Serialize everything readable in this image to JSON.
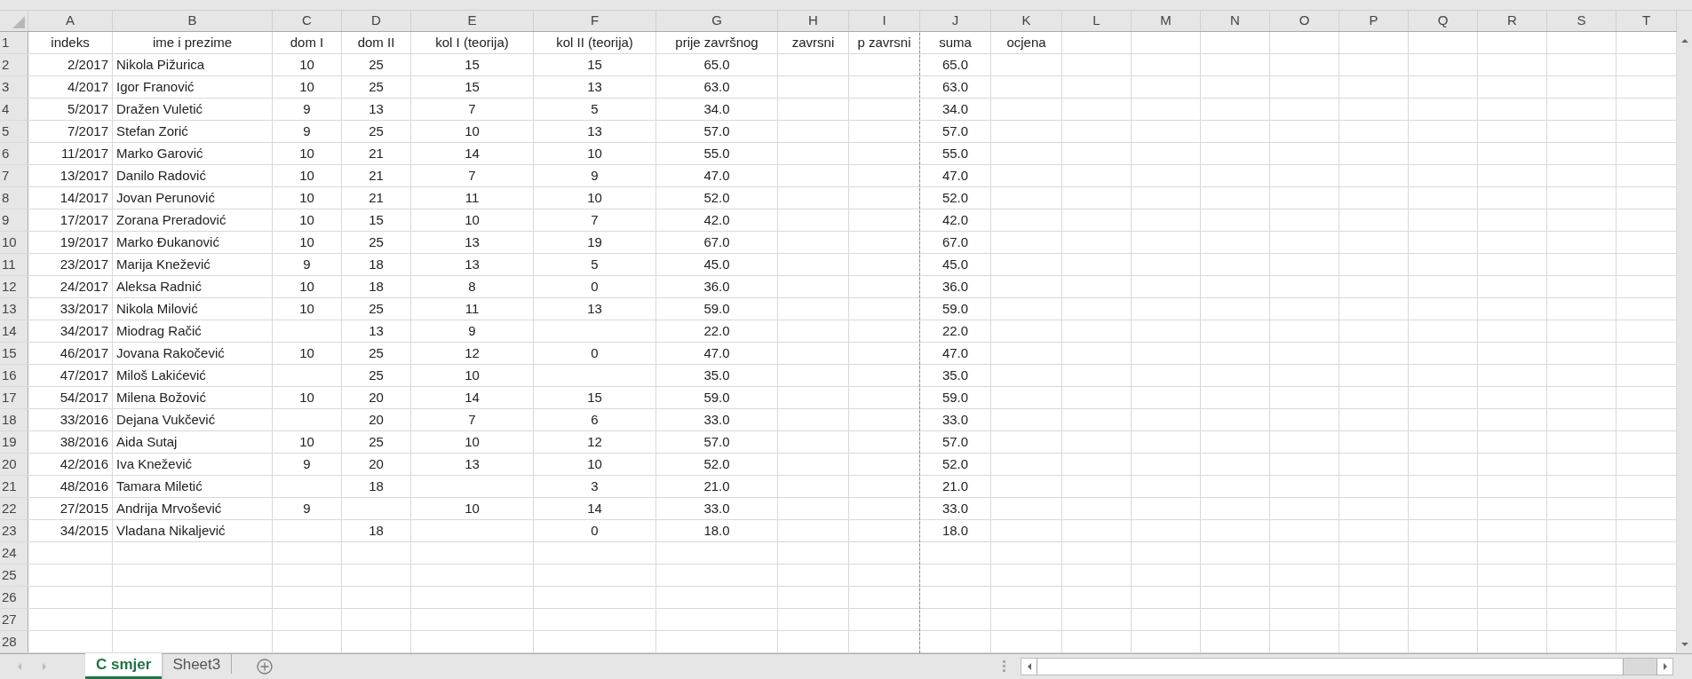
{
  "columns": [
    "A",
    "B",
    "C",
    "D",
    "E",
    "F",
    "G",
    "H",
    "I",
    "J",
    "K",
    "L",
    "M",
    "N",
    "O",
    "P",
    "Q",
    "R",
    "S",
    "T"
  ],
  "rows": [
    {
      "number": "1",
      "cells": [
        "indeks",
        "ime i prezime",
        "dom I",
        "dom II",
        "kol I (teorija)",
        "kol II (teorija)",
        "prije završnog",
        "zavrsni",
        "p zavrsni",
        "suma",
        "ocjena"
      ]
    },
    {
      "number": "2",
      "cells": [
        "2/2017",
        "Nikola Pižurica",
        "10",
        "25",
        "15",
        "15",
        "65.0",
        null,
        null,
        "65.0",
        null
      ]
    },
    {
      "number": "3",
      "cells": [
        "4/2017",
        "Igor Franović",
        "10",
        "25",
        "15",
        "13",
        "63.0",
        null,
        null,
        "63.0",
        null
      ]
    },
    {
      "number": "4",
      "cells": [
        "5/2017",
        "Dražen Vuletić",
        "9",
        "13",
        "7",
        "5",
        "34.0",
        null,
        null,
        "34.0",
        null
      ]
    },
    {
      "number": "5",
      "cells": [
        "7/2017",
        "Stefan Zorić",
        "9",
        "25",
        "10",
        "13",
        "57.0",
        null,
        null,
        "57.0",
        null
      ]
    },
    {
      "number": "6",
      "cells": [
        "11/2017",
        "Marko Garović",
        "10",
        "21",
        "14",
        "10",
        "55.0",
        null,
        null,
        "55.0",
        null
      ]
    },
    {
      "number": "7",
      "cells": [
        "13/2017",
        "Danilo Radović",
        "10",
        "21",
        "7",
        "9",
        "47.0",
        null,
        null,
        "47.0",
        null
      ]
    },
    {
      "number": "8",
      "cells": [
        "14/2017",
        "Jovan Perunović",
        "10",
        "21",
        "11",
        "10",
        "52.0",
        null,
        null,
        "52.0",
        null
      ]
    },
    {
      "number": "9",
      "cells": [
        "17/2017",
        "Zorana Preradović",
        "10",
        "15",
        "10",
        "7",
        "42.0",
        null,
        null,
        "42.0",
        null
      ]
    },
    {
      "number": "10",
      "cells": [
        "19/2017",
        "Marko Đukanović",
        "10",
        "25",
        "13",
        "19",
        "67.0",
        null,
        null,
        "67.0",
        null
      ]
    },
    {
      "number": "11",
      "cells": [
        "23/2017",
        "Marija Knežević",
        "9",
        "18",
        "13",
        "5",
        "45.0",
        null,
        null,
        "45.0",
        null
      ]
    },
    {
      "number": "12",
      "cells": [
        "24/2017",
        "Aleksa Radnić",
        "10",
        "18",
        "8",
        "0",
        "36.0",
        null,
        null,
        "36.0",
        null
      ]
    },
    {
      "number": "13",
      "cells": [
        "33/2017",
        "Nikola Milović",
        "10",
        "25",
        "11",
        "13",
        "59.0",
        null,
        null,
        "59.0",
        null
      ]
    },
    {
      "number": "14",
      "cells": [
        "34/2017",
        "Miodrag Račić",
        null,
        "13",
        "9",
        null,
        "22.0",
        null,
        null,
        "22.0",
        null
      ]
    },
    {
      "number": "15",
      "cells": [
        "46/2017",
        "Jovana Rakočević",
        "10",
        "25",
        "12",
        "0",
        "47.0",
        null,
        null,
        "47.0",
        null
      ]
    },
    {
      "number": "16",
      "cells": [
        "47/2017",
        "Miloš Lakićević",
        null,
        "25",
        "10",
        null,
        "35.0",
        null,
        null,
        "35.0",
        null
      ]
    },
    {
      "number": "17",
      "cells": [
        "54/2017",
        "Milena Božović",
        "10",
        "20",
        "14",
        "15",
        "59.0",
        null,
        null,
        "59.0",
        null
      ]
    },
    {
      "number": "18",
      "cells": [
        "33/2016",
        "Dejana Vukčević",
        null,
        "20",
        "7",
        "6",
        "33.0",
        null,
        null,
        "33.0",
        null
      ]
    },
    {
      "number": "19",
      "cells": [
        "38/2016",
        "Aida Sutaj",
        "10",
        "25",
        "10",
        "12",
        "57.0",
        null,
        null,
        "57.0",
        null
      ]
    },
    {
      "number": "20",
      "cells": [
        "42/2016",
        "Iva Knežević",
        "9",
        "20",
        "13",
        "10",
        "52.0",
        null,
        null,
        "52.0",
        null
      ]
    },
    {
      "number": "21",
      "cells": [
        "48/2016",
        "Tamara Miletić",
        null,
        "18",
        null,
        "3",
        "21.0",
        null,
        null,
        "21.0",
        null
      ]
    },
    {
      "number": "22",
      "cells": [
        "27/2015",
        "Andrija Mrvošević",
        "9",
        null,
        "10",
        "14",
        "33.0",
        null,
        null,
        "33.0",
        null
      ]
    },
    {
      "number": "23",
      "cells": [
        "34/2015",
        "Vladana Nikaljević",
        null,
        "18",
        null,
        "0",
        "18.0",
        null,
        null,
        "18.0",
        null
      ]
    },
    {
      "number": "24"
    },
    {
      "number": "25"
    },
    {
      "number": "26"
    },
    {
      "number": "27"
    },
    {
      "number": "28"
    }
  ],
  "sheet_tabs": [
    {
      "label": "C smjer",
      "selected": true
    },
    {
      "label": "Sheet3",
      "selected": false
    }
  ]
}
